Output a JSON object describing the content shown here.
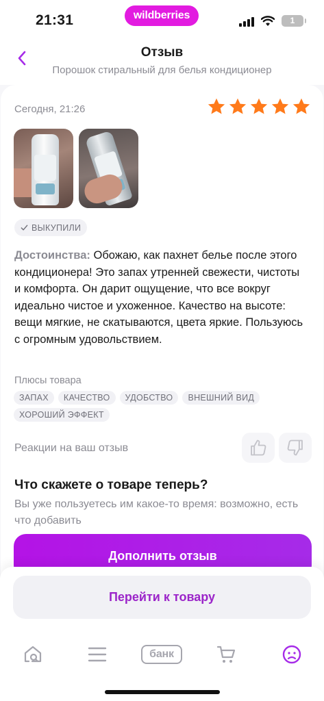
{
  "status_bar": {
    "time": "21:31",
    "brand": "wildberries",
    "battery": "1"
  },
  "header": {
    "title": "Отзыв",
    "subtitle": "Порошок стиральный для белья кондиционер"
  },
  "review": {
    "date": "Сегодня, 21:26",
    "rating": 5,
    "rating_color": "#ff7a1a",
    "bought_badge": "ВЫКУПИЛИ",
    "pros_lead": "Достоинства:",
    "text": "Обожаю, как пахнет белье после этого кондиционера! Это запах утренней свежести, чистоты и комфорта. Он дарит ощущение, что все вокруг идеально чистое и ухоженное. Качество на высоте: вещи мягкие, не скатываются, цвета яркие. Пользуюсь с огромным удовольствием.",
    "pros_title": "Плюсы товара",
    "tags": [
      "ЗАПАХ",
      "КАЧЕСТВО",
      "УДОБСТВО",
      "ВНЕШНИЙ ВИД",
      "ХОРОШИЙ ЭФФЕКТ"
    ],
    "reactions_label": "Реакции на ваш отзыв"
  },
  "cta": {
    "title": "Что скажете о товаре теперь?",
    "subtitle": "Вы уже пользуетесь им какое-то время: возможно, есть что добавить",
    "add_button": "Дополнить отзыв"
  },
  "bottom": {
    "goto_button": "Перейти к товару",
    "tabs": {
      "home": "home-search-icon",
      "catalog": "menu-icon",
      "bank": "банк",
      "cart": "cart-icon",
      "profile": "profile-icon"
    },
    "accent": "#a62be8"
  }
}
